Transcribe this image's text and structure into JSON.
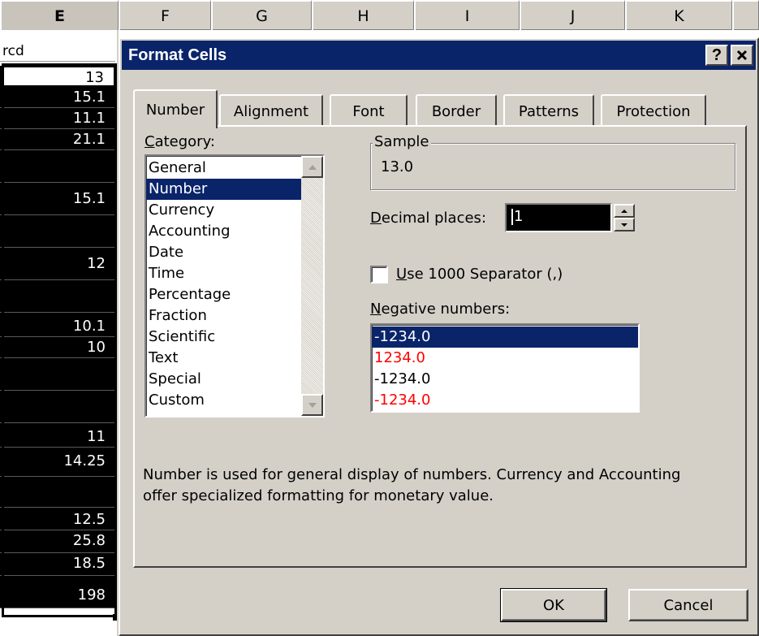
{
  "spreadsheet": {
    "columns": [
      "E",
      "F",
      "G",
      "H",
      "I",
      "J",
      "K"
    ],
    "header_cell": "rcd",
    "cells": [
      "13",
      "15.1",
      "11.1",
      "21.1",
      "",
      "15.1",
      "",
      "12",
      "",
      "10.1",
      "10",
      "",
      "",
      "11",
      "14.25",
      "",
      "12.5",
      "25.8",
      "18.5",
      "198"
    ]
  },
  "dialog": {
    "title": "Format Cells",
    "help_label": "?",
    "close_label": "✕",
    "tabs": [
      "Number",
      "Alignment",
      "Font",
      "Border",
      "Patterns",
      "Protection"
    ],
    "category_label_prefix": "",
    "category_label_hotkey": "C",
    "category_label_rest": "ategory:",
    "categories": [
      "General",
      "Number",
      "Currency",
      "Accounting",
      "Date",
      "Time",
      "Percentage",
      "Fraction",
      "Scientific",
      "Text",
      "Special",
      "Custom"
    ],
    "selected_category": "Number",
    "sample_legend": "Sample",
    "sample_value": "13.0",
    "decimal_label_hotkey": "D",
    "decimal_label_rest": "ecimal places:",
    "decimal_value": "1",
    "separator_hotkey": "U",
    "separator_rest": "se 1000 Separator (,)",
    "negative_hotkey": "N",
    "negative_rest": "egative numbers:",
    "negative_options": [
      "-1234.0",
      "1234.0",
      "-1234.0",
      "-1234.0"
    ],
    "description_line1": "Number is used for general display of numbers.  Currency and Accounting",
    "description_line2": "offer specialized formatting for monetary value.",
    "ok_label": "OK",
    "cancel_label": "Cancel"
  },
  "colors": {
    "titlebar": "#0a246a",
    "selection": "#0a246a",
    "negative_red": "#ff0000",
    "face": "#d4d0c8"
  }
}
